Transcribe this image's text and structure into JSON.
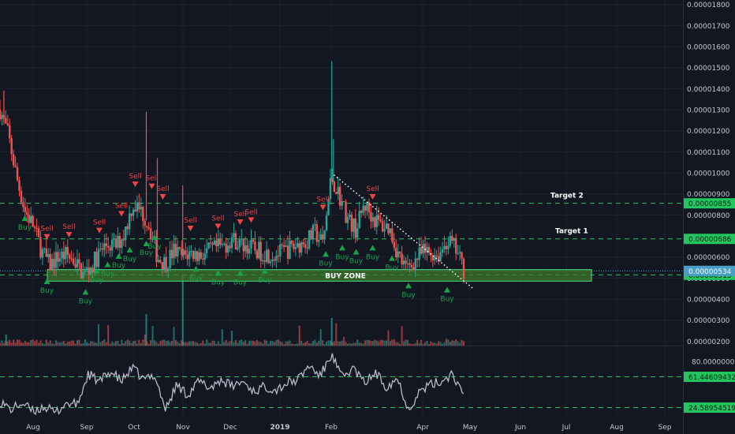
{
  "chart_data": [
    {
      "type": "candlestick",
      "title": "",
      "price_axis_labels": [
        "0.00001800",
        "0.00001700",
        "0.00001600",
        "0.00001500",
        "0.00001400",
        "0.00001300",
        "0.00001200",
        "0.00001100",
        "0.00001000",
        "0.00000900",
        "0.00000800",
        "0.00000600",
        "0.00000500",
        "0.00000400",
        "0.00000300",
        "0.00000200"
      ],
      "ylim": [
        1.9e-06,
        1.81e-05
      ],
      "time_labels": [
        "Aug",
        "Sep",
        "Oct",
        "Nov",
        "Dec",
        "2019",
        "Feb",
        "Apr",
        "May",
        "Jun",
        "Jul",
        "Aug",
        "Sep"
      ],
      "current_price": "0.00000534",
      "levels": [
        {
          "name": "Target 2",
          "value": "0.00000855",
          "color": "#22c55e"
        },
        {
          "name": "Target 1",
          "value": "0.00000686",
          "color": "#22c55e"
        },
        {
          "name": "",
          "value": "0.00000515",
          "color": "#22c55e"
        }
      ],
      "buy_zone": {
        "label": "BUY ZONE",
        "low": 4.85e-06,
        "high": 5.4e-06
      },
      "buy_signal_label": "Buy",
      "sell_signal_label": "Sell",
      "signal_count": {
        "buy": 20,
        "sell": 13
      },
      "price_path": [
        [
          0.0,
          1.3e-05
        ],
        [
          0.015,
          1.18e-05
        ],
        [
          0.03,
          9.8e-06
        ],
        [
          0.045,
          8.2e-06
        ],
        [
          0.06,
          7.5e-06
        ],
        [
          0.075,
          6.3e-06
        ],
        [
          0.09,
          5.6e-06
        ],
        [
          0.105,
          6e-06
        ],
        [
          0.12,
          6.1e-06
        ],
        [
          0.135,
          5.8e-06
        ],
        [
          0.15,
          5.2e-06
        ],
        [
          0.165,
          5.5e-06
        ],
        [
          0.18,
          6.2e-06
        ],
        [
          0.195,
          6.6e-06
        ],
        [
          0.21,
          6.5e-06
        ],
        [
          0.225,
          7.1e-06
        ],
        [
          0.24,
          8.5e-06
        ],
        [
          0.255,
          8.2e-06
        ],
        [
          0.27,
          7.5e-06
        ],
        [
          0.285,
          6e-06
        ],
        [
          0.3,
          5.7e-06
        ],
        [
          0.315,
          6.3e-06
        ],
        [
          0.33,
          6e-06
        ],
        [
          0.345,
          6.2e-06
        ],
        [
          0.36,
          6.1e-06
        ],
        [
          0.375,
          6.2e-06
        ],
        [
          0.39,
          6.4e-06
        ],
        [
          0.405,
          6.5e-06
        ],
        [
          0.42,
          6.9e-06
        ],
        [
          0.435,
          6.6e-06
        ],
        [
          0.45,
          6.5e-06
        ],
        [
          0.465,
          6.3e-06
        ],
        [
          0.48,
          6.2e-06
        ],
        [
          0.495,
          6.1e-06
        ],
        [
          0.51,
          6.2e-06
        ],
        [
          0.525,
          6.4e-06
        ],
        [
          0.54,
          6.6e-06
        ],
        [
          0.555,
          6.7e-06
        ],
        [
          0.57,
          7.2e-06
        ],
        [
          0.585,
          6.6e-06
        ],
        [
          0.6,
          9.8e-06
        ],
        [
          0.615,
          8.9e-06
        ],
        [
          0.63,
          7.8e-06
        ],
        [
          0.645,
          7.3e-06
        ],
        [
          0.66,
          8.5e-06
        ],
        [
          0.675,
          7.9e-06
        ],
        [
          0.69,
          7.5e-06
        ],
        [
          0.705,
          7.4e-06
        ],
        [
          0.72,
          6.2e-06
        ],
        [
          0.735,
          5.4e-06
        ],
        [
          0.75,
          5.8e-06
        ],
        [
          0.765,
          6.2e-06
        ],
        [
          0.78,
          6.2e-06
        ],
        [
          0.795,
          6.1e-06
        ],
        [
          0.81,
          6.8e-06
        ],
        [
          0.825,
          6.4e-06
        ],
        [
          0.84,
          5.4e-06
        ]
      ],
      "spikes": [
        [
          0.007,
          1.39e-05
        ],
        [
          0.265,
          1.29e-05
        ],
        [
          0.285,
          1.07e-05
        ],
        [
          0.331,
          9.4e-06
        ],
        [
          0.601,
          1.53e-05
        ],
        [
          0.604,
          1.16e-05
        ]
      ],
      "signals": [
        {
          "type": "buy",
          "t": 0.045,
          "price": 8.2e-06
        },
        {
          "type": "buy",
          "t": 0.085,
          "price": 5.2e-06
        },
        {
          "type": "buy",
          "t": 0.155,
          "price": 4.7e-06
        },
        {
          "type": "buy",
          "t": 0.175,
          "price": 5.7e-06
        },
        {
          "type": "buy",
          "t": 0.195,
          "price": 6e-06
        },
        {
          "type": "buy",
          "t": 0.215,
          "price": 6.4e-06
        },
        {
          "type": "buy",
          "t": 0.235,
          "price": 6.7e-06
        },
        {
          "type": "buy",
          "t": 0.265,
          "price": 7e-06
        },
        {
          "type": "buy",
          "t": 0.28,
          "price": 7.3e-06
        },
        {
          "type": "buy",
          "t": 0.355,
          "price": 5.8e-06
        },
        {
          "type": "buy",
          "t": 0.395,
          "price": 5.6e-06
        },
        {
          "type": "buy",
          "t": 0.435,
          "price": 5.6e-06
        },
        {
          "type": "buy",
          "t": 0.48,
          "price": 5.7e-06
        },
        {
          "type": "buy",
          "t": 0.59,
          "price": 6.5e-06
        },
        {
          "type": "buy",
          "t": 0.62,
          "price": 6.8e-06
        },
        {
          "type": "buy",
          "t": 0.645,
          "price": 6.6e-06
        },
        {
          "type": "buy",
          "t": 0.675,
          "price": 6.8e-06
        },
        {
          "type": "buy",
          "t": 0.71,
          "price": 6.3e-06
        },
        {
          "type": "buy",
          "t": 0.74,
          "price": 5e-06
        },
        {
          "type": "buy",
          "t": 0.81,
          "price": 4.8e-06
        },
        {
          "type": "sell",
          "t": 0.085,
          "price": 6.6e-06
        },
        {
          "type": "sell",
          "t": 0.125,
          "price": 6.7e-06
        },
        {
          "type": "sell",
          "t": 0.18,
          "price": 6.9e-06
        },
        {
          "type": "sell",
          "t": 0.22,
          "price": 7.7e-06
        },
        {
          "type": "sell",
          "t": 0.245,
          "price": 9.1e-06
        },
        {
          "type": "sell",
          "t": 0.275,
          "price": 9e-06
        },
        {
          "type": "sell",
          "t": 0.295,
          "price": 8.5e-06
        },
        {
          "type": "sell",
          "t": 0.345,
          "price": 7e-06
        },
        {
          "type": "sell",
          "t": 0.395,
          "price": 7.1e-06
        },
        {
          "type": "sell",
          "t": 0.435,
          "price": 7.3e-06
        },
        {
          "type": "sell",
          "t": 0.455,
          "price": 7.4e-06
        },
        {
          "type": "sell",
          "t": 0.585,
          "price": 8e-06
        },
        {
          "type": "sell",
          "t": 0.675,
          "price": 8.5e-06
        }
      ]
    },
    {
      "type": "line",
      "title": "",
      "axis_labels": [
        "80.00000000"
      ],
      "levels": [
        {
          "value": "61.44609432",
          "color": "#22c55e"
        },
        {
          "value": "24.58954519",
          "color": "#22c55e"
        }
      ],
      "ylim": [
        10,
        95
      ],
      "oscillator_path": [
        [
          0.0,
          32
        ],
        [
          0.02,
          22
        ],
        [
          0.04,
          30
        ],
        [
          0.06,
          20
        ],
        [
          0.08,
          26
        ],
        [
          0.1,
          18
        ],
        [
          0.12,
          30
        ],
        [
          0.14,
          28
        ],
        [
          0.16,
          65
        ],
        [
          0.18,
          55
        ],
        [
          0.2,
          68
        ],
        [
          0.22,
          56
        ],
        [
          0.24,
          72
        ],
        [
          0.26,
          58
        ],
        [
          0.28,
          64
        ],
        [
          0.3,
          22
        ],
        [
          0.32,
          52
        ],
        [
          0.34,
          40
        ],
        [
          0.36,
          56
        ],
        [
          0.38,
          48
        ],
        [
          0.4,
          58
        ],
        [
          0.42,
          50
        ],
        [
          0.44,
          56
        ],
        [
          0.46,
          44
        ],
        [
          0.48,
          50
        ],
        [
          0.5,
          46
        ],
        [
          0.52,
          54
        ],
        [
          0.54,
          58
        ],
        [
          0.56,
          75
        ],
        [
          0.58,
          62
        ],
        [
          0.6,
          88
        ],
        [
          0.62,
          60
        ],
        [
          0.64,
          72
        ],
        [
          0.66,
          54
        ],
        [
          0.68,
          66
        ],
        [
          0.7,
          50
        ],
        [
          0.72,
          60
        ],
        [
          0.74,
          22
        ],
        [
          0.76,
          44
        ],
        [
          0.78,
          52
        ],
        [
          0.8,
          56
        ],
        [
          0.82,
          66
        ],
        [
          0.84,
          36
        ]
      ]
    }
  ],
  "colors": {
    "background": "#131722",
    "grid": "#1e222d",
    "up": "#26a69a",
    "down": "#ef5350",
    "level": "#22c55e",
    "buy_zone_fill": "#3e7a2b",
    "buy_signal": "#16a34a",
    "sell_signal": "#ef4444",
    "current_price": "#4a9fc6",
    "oscillator_line": "#b8bcc8",
    "axis_text": "#c5c8d2"
  }
}
